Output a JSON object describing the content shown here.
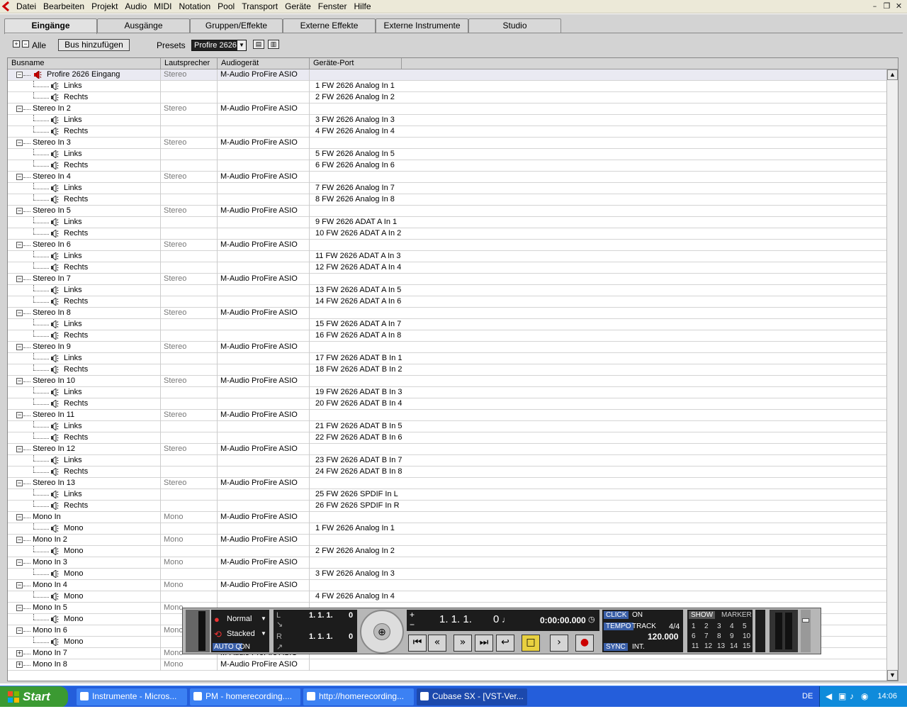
{
  "menubar": {
    "items": [
      "Datei",
      "Bearbeiten",
      "Projekt",
      "Audio",
      "MIDI",
      "Notation",
      "Pool",
      "Transport",
      "Geräte",
      "Fenster",
      "Hilfe"
    ]
  },
  "tabs": [
    "Eingänge",
    "Ausgänge",
    "Gruppen/Effekte",
    "Externe Effekte",
    "Externe Instrumente",
    "Studio"
  ],
  "toolbar": {
    "all_label": "Alle",
    "add_bus_label": "Bus hinzufügen",
    "presets_label": "Presets",
    "preset_value": "Profire 2626"
  },
  "columns": [
    "Busname",
    "Lautsprecher",
    "Audiogerät",
    "Geräte-Port"
  ],
  "rows": [
    {
      "level": 0,
      "name": "Profire 2626 Eingang",
      "speaker": "Stereo",
      "device": "M-Audio ProFire ASIO",
      "port": "",
      "icon": true,
      "expanded": true
    },
    {
      "level": 1,
      "name": "Links",
      "speaker": "",
      "device": "",
      "port": "1 FW 2626 Analog In 1"
    },
    {
      "level": 1,
      "name": "Rechts",
      "speaker": "",
      "device": "",
      "port": "2 FW 2626 Analog In 2"
    },
    {
      "level": 0,
      "name": "Stereo In 2",
      "speaker": "Stereo",
      "device": "M-Audio ProFire ASIO",
      "port": "",
      "expanded": true
    },
    {
      "level": 1,
      "name": "Links",
      "speaker": "",
      "device": "",
      "port": "3 FW 2626 Analog In 3"
    },
    {
      "level": 1,
      "name": "Rechts",
      "speaker": "",
      "device": "",
      "port": "4 FW 2626 Analog In 4"
    },
    {
      "level": 0,
      "name": "Stereo In 3",
      "speaker": "Stereo",
      "device": "M-Audio ProFire ASIO",
      "port": "",
      "expanded": true
    },
    {
      "level": 1,
      "name": "Links",
      "speaker": "",
      "device": "",
      "port": "5 FW 2626 Analog In 5"
    },
    {
      "level": 1,
      "name": "Rechts",
      "speaker": "",
      "device": "",
      "port": "6 FW 2626 Analog In 6"
    },
    {
      "level": 0,
      "name": "Stereo In 4",
      "speaker": "Stereo",
      "device": "M-Audio ProFire ASIO",
      "port": "",
      "expanded": true
    },
    {
      "level": 1,
      "name": "Links",
      "speaker": "",
      "device": "",
      "port": "7 FW 2626 Analog In 7"
    },
    {
      "level": 1,
      "name": "Rechts",
      "speaker": "",
      "device": "",
      "port": "8 FW 2626 Analog In 8"
    },
    {
      "level": 0,
      "name": "Stereo In 5",
      "speaker": "Stereo",
      "device": "M-Audio ProFire ASIO",
      "port": "",
      "expanded": true
    },
    {
      "level": 1,
      "name": "Links",
      "speaker": "",
      "device": "",
      "port": "9 FW 2626 ADAT A In 1"
    },
    {
      "level": 1,
      "name": "Rechts",
      "speaker": "",
      "device": "",
      "port": "10 FW 2626 ADAT A In 2"
    },
    {
      "level": 0,
      "name": "Stereo In 6",
      "speaker": "Stereo",
      "device": "M-Audio ProFire ASIO",
      "port": "",
      "expanded": true
    },
    {
      "level": 1,
      "name": "Links",
      "speaker": "",
      "device": "",
      "port": "11 FW 2626 ADAT A In 3"
    },
    {
      "level": 1,
      "name": "Rechts",
      "speaker": "",
      "device": "",
      "port": "12 FW 2626 ADAT A In 4"
    },
    {
      "level": 0,
      "name": "Stereo In 7",
      "speaker": "Stereo",
      "device": "M-Audio ProFire ASIO",
      "port": "",
      "expanded": true
    },
    {
      "level": 1,
      "name": "Links",
      "speaker": "",
      "device": "",
      "port": "13 FW 2626 ADAT A In 5"
    },
    {
      "level": 1,
      "name": "Rechts",
      "speaker": "",
      "device": "",
      "port": "14 FW 2626 ADAT A In 6"
    },
    {
      "level": 0,
      "name": "Stereo In 8",
      "speaker": "Stereo",
      "device": "M-Audio ProFire ASIO",
      "port": "",
      "expanded": true
    },
    {
      "level": 1,
      "name": "Links",
      "speaker": "",
      "device": "",
      "port": "15 FW 2626 ADAT A In 7"
    },
    {
      "level": 1,
      "name": "Rechts",
      "speaker": "",
      "device": "",
      "port": "16 FW 2626 ADAT A In 8"
    },
    {
      "level": 0,
      "name": "Stereo In 9",
      "speaker": "Stereo",
      "device": "M-Audio ProFire ASIO",
      "port": "",
      "expanded": true
    },
    {
      "level": 1,
      "name": "Links",
      "speaker": "",
      "device": "",
      "port": "17 FW 2626 ADAT B In 1"
    },
    {
      "level": 1,
      "name": "Rechts",
      "speaker": "",
      "device": "",
      "port": "18 FW 2626 ADAT B In 2"
    },
    {
      "level": 0,
      "name": "Stereo In 10",
      "speaker": "Stereo",
      "device": "M-Audio ProFire ASIO",
      "port": "",
      "expanded": true
    },
    {
      "level": 1,
      "name": "Links",
      "speaker": "",
      "device": "",
      "port": "19 FW 2626 ADAT B In 3"
    },
    {
      "level": 1,
      "name": "Rechts",
      "speaker": "",
      "device": "",
      "port": "20 FW 2626 ADAT B In 4"
    },
    {
      "level": 0,
      "name": "Stereo In 11",
      "speaker": "Stereo",
      "device": "M-Audio ProFire ASIO",
      "port": "",
      "expanded": true
    },
    {
      "level": 1,
      "name": "Links",
      "speaker": "",
      "device": "",
      "port": "21 FW 2626 ADAT B In 5"
    },
    {
      "level": 1,
      "name": "Rechts",
      "speaker": "",
      "device": "",
      "port": "22 FW 2626 ADAT B In 6"
    },
    {
      "level": 0,
      "name": "Stereo In 12",
      "speaker": "Stereo",
      "device": "M-Audio ProFire ASIO",
      "port": "",
      "expanded": true
    },
    {
      "level": 1,
      "name": "Links",
      "speaker": "",
      "device": "",
      "port": "23 FW 2626 ADAT B In 7"
    },
    {
      "level": 1,
      "name": "Rechts",
      "speaker": "",
      "device": "",
      "port": "24 FW 2626 ADAT B In 8"
    },
    {
      "level": 0,
      "name": "Stereo In 13",
      "speaker": "Stereo",
      "device": "M-Audio ProFire ASIO",
      "port": "",
      "expanded": true
    },
    {
      "level": 1,
      "name": "Links",
      "speaker": "",
      "device": "",
      "port": "25 FW 2626 SPDIF In L"
    },
    {
      "level": 1,
      "name": "Rechts",
      "speaker": "",
      "device": "",
      "port": "26 FW 2626 SPDIF In R"
    },
    {
      "level": 0,
      "name": "Mono In",
      "speaker": "Mono",
      "device": "M-Audio ProFire ASIO",
      "port": "",
      "expanded": true
    },
    {
      "level": 1,
      "name": "Mono",
      "speaker": "",
      "device": "",
      "port": "1 FW 2626 Analog In 1"
    },
    {
      "level": 0,
      "name": "Mono In 2",
      "speaker": "Mono",
      "device": "M-Audio ProFire ASIO",
      "port": "",
      "expanded": true
    },
    {
      "level": 1,
      "name": "Mono",
      "speaker": "",
      "device": "",
      "port": "2 FW 2626 Analog In 2"
    },
    {
      "level": 0,
      "name": "Mono In 3",
      "speaker": "Mono",
      "device": "M-Audio ProFire ASIO",
      "port": "",
      "expanded": true
    },
    {
      "level": 1,
      "name": "Mono",
      "speaker": "",
      "device": "",
      "port": "3 FW 2626 Analog In 3"
    },
    {
      "level": 0,
      "name": "Mono In 4",
      "speaker": "Mono",
      "device": "M-Audio ProFire ASIO",
      "port": "",
      "expanded": true
    },
    {
      "level": 1,
      "name": "Mono",
      "speaker": "",
      "device": "",
      "port": "4 FW 2626 Analog In 4"
    },
    {
      "level": 0,
      "name": "Mono In 5",
      "speaker": "Mono",
      "device": "",
      "port": "",
      "expanded": true
    },
    {
      "level": 1,
      "name": "Mono",
      "speaker": "",
      "device": "",
      "port": ""
    },
    {
      "level": 0,
      "name": "Mono In 6",
      "speaker": "Mono",
      "device": "",
      "port": "",
      "expanded": true
    },
    {
      "level": 1,
      "name": "Mono",
      "speaker": "",
      "device": "",
      "port": ""
    },
    {
      "level": 0,
      "name": "Mono In 7",
      "speaker": "Mono",
      "device": "M-Audio ProFire ASIO",
      "port": "",
      "expanded": false
    },
    {
      "level": 0,
      "name": "Mono In 8",
      "speaker": "Mono",
      "device": "M-Audio ProFire ASIO",
      "port": "",
      "expanded": false
    }
  ],
  "transport": {
    "mode_normal": "Normal",
    "mode_stacked": "Stacked",
    "auto_q": "AUTO Q",
    "auto_q_state": "ON",
    "left_locator": "1. 1. 1.",
    "left_locator_ticks": "0",
    "right_locator": "1. 1. 1.",
    "right_locator_ticks": "0",
    "position_bars": "1. 1. 1.",
    "position_ticks": "0",
    "position_time": "0:00:00.000",
    "click_label": "CLICK",
    "click_state": "ON",
    "tempo_label": "TEMPO",
    "tempo_mode": "TRACK",
    "signature": "4/4",
    "tempo_value": "120.000",
    "sync_label": "SYNC",
    "sync_state": "INT.",
    "show_label": "SHOW",
    "marker_label": "MARKER",
    "markers": [
      "1",
      "2",
      "3",
      "4",
      "5",
      "6",
      "7",
      "8",
      "9",
      "10",
      "11",
      "12",
      "13",
      "14",
      "15"
    ]
  },
  "taskbar": {
    "start_label": "Start",
    "tasks": [
      {
        "label": "Instrumente - Micros...",
        "active": false
      },
      {
        "label": "PM - homerecording....",
        "active": false
      },
      {
        "label": "http://homerecording...",
        "active": false
      },
      {
        "label": "Cubase SX - [VST-Ver...",
        "active": true
      }
    ],
    "language": "DE",
    "clock": "14:06"
  },
  "colors": {
    "panel": "#d3d3d3",
    "xp_blue": "#245edb",
    "start_green": "#3b9a32",
    "record_red": "#cc0000",
    "stop_yellow": "#e8d040"
  }
}
